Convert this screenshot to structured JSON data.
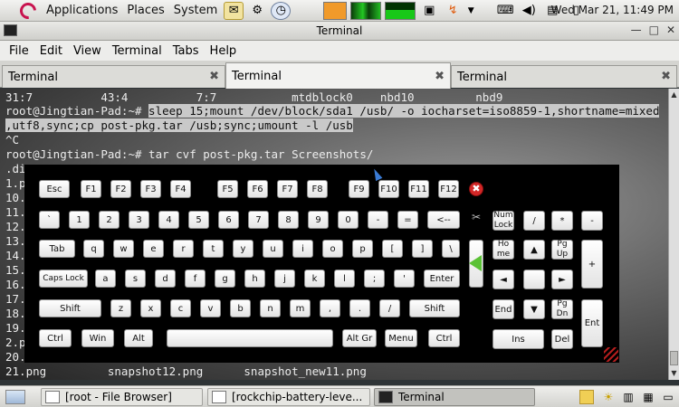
{
  "top_panel": {
    "menus": [
      "Applications",
      "Places",
      "System"
    ],
    "clock": "Wed Mar 21, 11:49 PM"
  },
  "window": {
    "title": "Terminal",
    "menus": [
      "File",
      "Edit",
      "View",
      "Terminal",
      "Tabs",
      "Help"
    ],
    "tabs": [
      {
        "label": "Terminal",
        "active": false
      },
      {
        "label": "Terminal",
        "active": true
      },
      {
        "label": "Terminal",
        "active": false
      }
    ]
  },
  "terminal": {
    "lines": [
      "31:7          43:4          7:7           mtdblock0    nbd10         nbd9",
      "root@Jingtian-Pad:~# ",
      "sleep 15;mount /dev/block/sda1 /usb/ -o iocharset=iso8859-1,shortname=mixed",
      ",utf8,sync;cp post-pkg.tar /usb;sync;umount -l /usb",
      "^C",
      "root@Jingtian-Pad:~# tar cvf post-pkg.tar Screenshots/",
      ".di",
      "1.p",
      "10.",
      "11.",
      "12.",
      "13.",
      "14.",
      "15.",
      "16.",
      "17.",
      "18.",
      "19.",
      "2.p",
      "20.",
      "21.png         snapshot12.png      snapshot_new11.png"
    ]
  },
  "keyboard": {
    "row_fn": [
      "Esc",
      "F1",
      "F2",
      "F3",
      "F4",
      "F5",
      "F6",
      "F7",
      "F8",
      "F9",
      "F10",
      "F11",
      "F12"
    ],
    "row_num": [
      "`",
      "1",
      "2",
      "3",
      "4",
      "5",
      "6",
      "7",
      "8",
      "9",
      "0",
      "-",
      "=",
      "<--"
    ],
    "row_q": [
      "Tab",
      "q",
      "w",
      "e",
      "r",
      "t",
      "y",
      "u",
      "i",
      "o",
      "p",
      "[",
      "]",
      "\\"
    ],
    "row_a": [
      "Caps Lock",
      "a",
      "s",
      "d",
      "f",
      "g",
      "h",
      "j",
      "k",
      "l",
      ";",
      "'",
      "Enter"
    ],
    "row_z": [
      "Shift",
      "z",
      "x",
      "c",
      "v",
      "b",
      "n",
      "m",
      ",",
      ".",
      "/",
      "Shift"
    ],
    "row_space": [
      "Ctrl",
      "Win",
      "Alt",
      "",
      "Alt Gr",
      "Menu",
      "Ctrl"
    ],
    "nav": [
      "Num\nLock",
      "/",
      "*",
      "-",
      "Ho\nme",
      "▲",
      "Pg\nUp",
      "+",
      "◄",
      "",
      "►",
      "End",
      "▼",
      "Pg\nDn",
      "Ent",
      "Ins",
      "Del"
    ],
    "close_symbol": "✖",
    "split_symbol": "✂"
  },
  "taskbar": {
    "tasks": [
      {
        "label": "[root - File Browser]",
        "active": false
      },
      {
        "label": "[rockchip-battery-leve...",
        "active": false
      },
      {
        "label": "Terminal",
        "active": true
      }
    ]
  }
}
